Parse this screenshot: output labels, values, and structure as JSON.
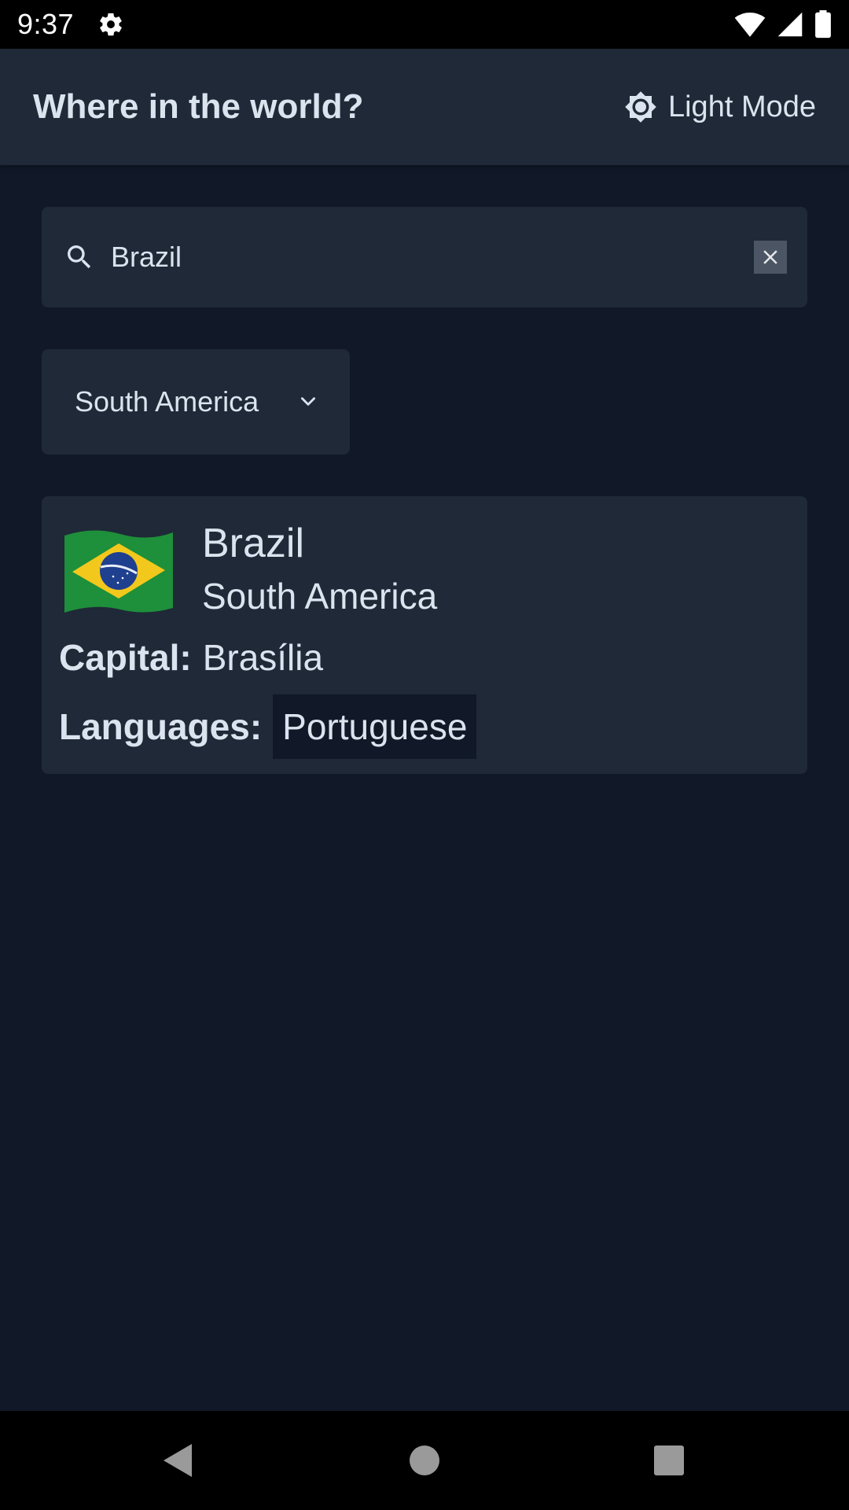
{
  "status_bar": {
    "time": "9:37",
    "icons": [
      "settings-icon",
      "wifi-icon",
      "signal-icon",
      "battery-icon"
    ]
  },
  "app_bar": {
    "title": "Where in the world?",
    "mode_toggle_label": "Light Mode",
    "mode_icon": "sun-icon"
  },
  "search": {
    "value": "Brazil",
    "icon": "search-icon",
    "clear_icon": "close-icon"
  },
  "region_filter": {
    "selected": "South America",
    "icon": "chevron-down-icon"
  },
  "results": [
    {
      "flag": "brazil-flag",
      "name": "Brazil",
      "region": "South America",
      "capital_label": "Capital:",
      "capital": "Brasília",
      "languages_label": "Languages:",
      "languages": [
        "Portuguese"
      ]
    }
  ],
  "nav_bar": {
    "buttons": [
      "back-icon",
      "home-icon",
      "recents-icon"
    ]
  },
  "colors": {
    "background": "#111827",
    "surface": "#1f2937",
    "text": "#dbe3ee",
    "chip": "#111827"
  }
}
